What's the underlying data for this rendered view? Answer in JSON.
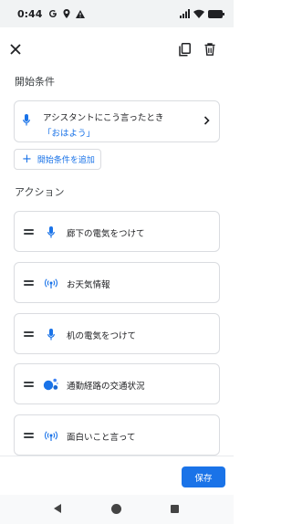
{
  "status_bar": {
    "time": "0:44",
    "left_icons": [
      "google-g-icon",
      "location-pin-icon",
      "warning-icon"
    ],
    "right_icons": [
      "signal-icon",
      "wifi-icon",
      "battery-icon"
    ]
  },
  "topbar": {
    "icons": [
      "close-icon",
      "copy-icon",
      "delete-icon"
    ]
  },
  "starter_section": {
    "title": "開始条件",
    "card": {
      "line1": "アシスタントにこう言ったとき",
      "line2": "「おはよう」",
      "icon": "mic-icon"
    },
    "add_button": "開始条件を追加"
  },
  "actions_section": {
    "title": "アクション",
    "items": [
      {
        "label": "廊下の電気をつけて",
        "icon": "mic-icon"
      },
      {
        "label": "お天気情報",
        "icon": "broadcast-icon"
      },
      {
        "label": "机の電気をつけて",
        "icon": "mic-icon"
      },
      {
        "label": "通勤経路の交通状況",
        "icon": "assistant-icon"
      },
      {
        "label": "面白いこと言って",
        "icon": "broadcast-icon"
      }
    ]
  },
  "footer": {
    "save_label": "保存"
  },
  "colors": {
    "accent": "#1a73e8",
    "status_bar_bg": "#f1f3f4",
    "card_border": "#dadce0"
  }
}
